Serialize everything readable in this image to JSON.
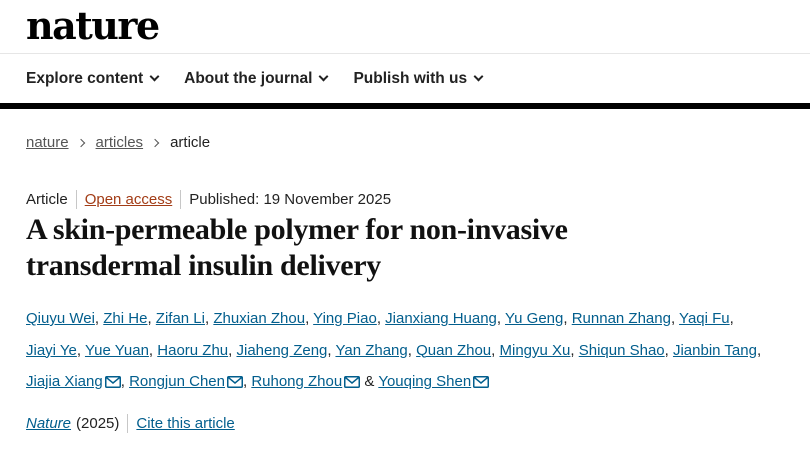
{
  "header": {
    "logo": "nature"
  },
  "nav": {
    "items": [
      {
        "label": "Explore content"
      },
      {
        "label": "About the journal"
      },
      {
        "label": "Publish with us"
      }
    ]
  },
  "breadcrumb": {
    "items": [
      "nature",
      "articles",
      "article"
    ]
  },
  "meta": {
    "type": "Article",
    "access": "Open access",
    "published": "Published: 19 November 2025"
  },
  "title": "A skin-permeable polymer for non-invasive transdermal insulin delivery",
  "authors": {
    "names": [
      "Qiuyu Wei",
      "Zhi He",
      "Zifan Li",
      "Zhuxian Zhou",
      "Ying Piao",
      "Jianxiang Huang",
      "Yu Geng",
      "Runnan Zhang",
      "Yaqi Fu",
      "Jiayi Ye",
      "Yue Yuan",
      "Haoru Zhu",
      "Jiaheng Zeng",
      "Yan Zhang",
      "Quan Zhou",
      "Mingyu Xu",
      "Shiqun Shao",
      "Jianbin Tang",
      "Jiajia Xiang",
      "Rongjun Chen",
      "Ruhong Zhou",
      "Youqing Shen"
    ],
    "conjunction": "&",
    "corresponding": [
      "Jiajia Xiang",
      "Rongjun Chen",
      "Ruhong Zhou",
      "Youqing Shen"
    ]
  },
  "citation": {
    "journal": "Nature",
    "year": "(2025)",
    "cite_label": "Cite this article"
  },
  "colors": {
    "link": "#025e8d",
    "open_access": "#a23c16",
    "nav_border": "#000000"
  }
}
